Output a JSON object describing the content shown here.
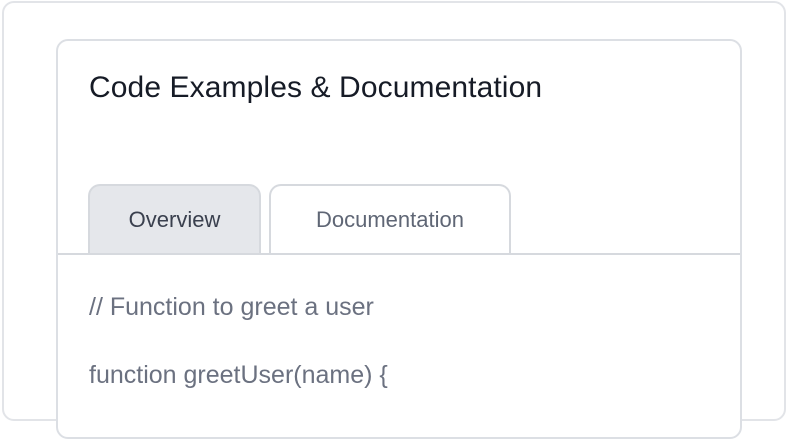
{
  "card": {
    "title": "Code Examples & Documentation"
  },
  "tabs": [
    {
      "label": "Overview",
      "active": true
    },
    {
      "label": "Documentation",
      "active": false
    }
  ],
  "code": {
    "lines": [
      "// Function to greet a user",
      "function greetUser(name) {"
    ]
  },
  "colors": {
    "active_tab_bg": "#e5e7eb",
    "border": "#d6d9de",
    "title_text": "#161b26",
    "code_text": "#6b7180"
  }
}
